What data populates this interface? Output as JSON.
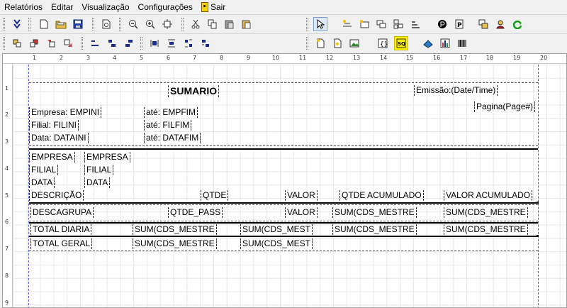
{
  "menu": {
    "items": [
      "Relatórios",
      "Editar",
      "Visualização",
      "Configurações"
    ],
    "exit_label": "Sair"
  },
  "toolbar_icons": {
    "row1": [
      "compile-down-icon",
      "new-document-icon",
      "open-folder-icon",
      "save-icon",
      "print-preview-icon",
      "zoom-out-icon",
      "zoom-in-icon",
      "zoom-fit-icon",
      "cut-icon",
      "copy-icon",
      "paste-icon",
      "paste-special-icon",
      "select-arrow-icon",
      "insert-label-icon",
      "insert-field-icon",
      "insert-group-icon",
      "insert-multi-icon",
      "insert-line-icon",
      "data-source-icon",
      "page-property-icon",
      "band-icon",
      "user-icon",
      "refresh-icon"
    ],
    "row2": [
      "align-left-icon",
      "align-right-icon",
      "align-front-icon",
      "align-back-icon",
      "distribute-h-icon",
      "distribute-v-icon",
      "bring-forward-icon",
      "send-back-icon",
      "space-h-icon",
      "space-v-icon",
      "equal-size-icon",
      "equal-width-icon",
      "insert-page-icon",
      "insert-sub-icon",
      "insert-image-icon",
      "insert-expression-icon",
      "insert-sql-icon",
      "insert-shape-icon",
      "insert-chart-icon",
      "insert-barcode-icon"
    ]
  },
  "ruler": {
    "top": [
      "1",
      "2",
      "3",
      "4",
      "5",
      "6",
      "7",
      "8",
      "9",
      "10",
      "11",
      "12",
      "13",
      "14",
      "15",
      "16",
      "17",
      "18",
      "19",
      "20"
    ],
    "left": [
      "1",
      "2",
      "3",
      "4",
      "5",
      "6",
      "7",
      "8",
      "9"
    ]
  },
  "report": {
    "title": "SUMARIO",
    "emissao": "Emissão:(Date/Time)",
    "pagina": "Pagina(Page#)",
    "empresa_de": "Empresa: EMPINI",
    "empresa_ate": "até: EMPFIM",
    "filial_de": "Filial: FILINI",
    "filial_ate": "até: FILFIM",
    "data_de": "Data: DATAINI",
    "data_ate": "até: DATAFIM",
    "hdr_empresa": "EMPRESA",
    "hdr_empresa_val": "EMPRESA",
    "hdr_filial": "FILIAL",
    "hdr_filial_val": "FILIAL",
    "hdr_data": "DATA",
    "hdr_data_val": "DATA",
    "col_descricao": "DESCRIÇÃO",
    "col_qtde": "QTDE",
    "col_valor": "VALOR",
    "col_qtde_acum": "QTDE ACUMULADO",
    "col_valor_acum": "VALOR ACUMULADO",
    "det_desc": "DESCAGRUPA",
    "det_qtde": "QTDE_PASS",
    "det_valor": "VALOR",
    "det_sum1": "SUM(CDS_MESTRE",
    "det_sum2": "SUM(CDS_MESTRE",
    "td_label": "TOTAL DIARIA",
    "td_sum1": "SUM(CDS_MESTRE",
    "td_sum2": "SUM(CDS_MEST",
    "td_sum3": "SUM(CDS_MESTRE",
    "td_sum4": "SUM(CDS_MESTRE",
    "tg_label": "TOTAL GERAL",
    "tg_sum1": "SUM(CDS_MESTRE",
    "tg_sum2": "SUM(CDS_MEST"
  }
}
